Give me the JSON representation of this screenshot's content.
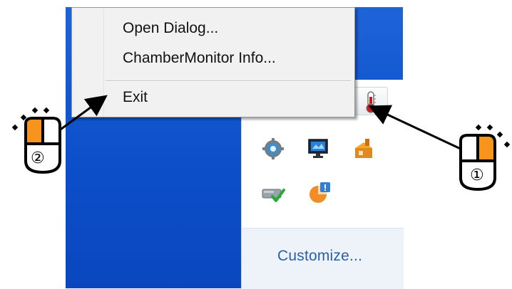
{
  "context_menu": {
    "items": [
      {
        "label": "Open Dialog..."
      },
      {
        "label": "ChamberMonitor Info..."
      },
      {
        "label": "Exit"
      }
    ]
  },
  "tray_panel": {
    "customize_label": "Customize...",
    "icons": [
      "chamber-monitor-thermometer-icon",
      "settings-gear-icon",
      "monitor-network-icon",
      "security-shield-icon",
      "drive-check-icon",
      "update-info-icon"
    ]
  },
  "callouts": {
    "step1": "①",
    "step2": "②"
  },
  "colors": {
    "desktop_blue": "#0c4fc9",
    "mouse_highlight": "#f7941d",
    "link_blue": "#2a5fa8"
  }
}
